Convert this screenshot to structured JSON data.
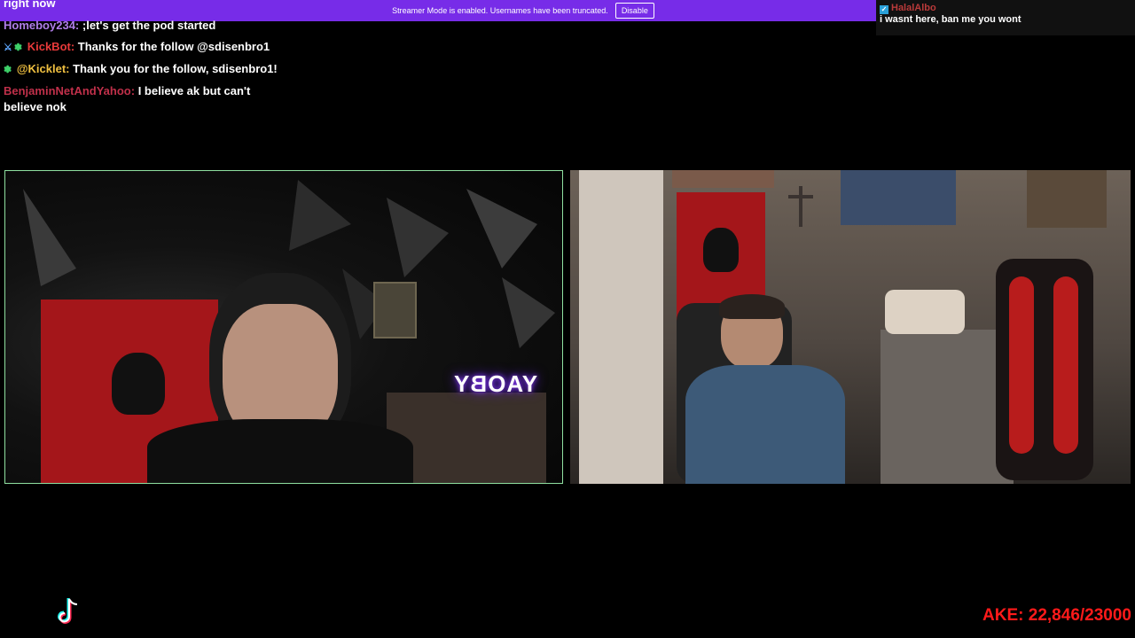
{
  "top_line": "right now",
  "banner": {
    "message": "Streamer Mode is enabled. Usernames have been truncated.",
    "button_label": "Disable",
    "color": "#772ce8"
  },
  "chat": [
    {
      "user": "Homeboy234:",
      "user_color": "#b07ee8",
      "text": ";let's get the pod started",
      "badges": []
    },
    {
      "user": "KickBot:",
      "user_color": "#e83a3a",
      "text": "Thanks for the follow @sdisenbro1",
      "badges": [
        "sword-icon",
        "gear-badge-icon"
      ]
    },
    {
      "user": "@Kicklet:",
      "user_color": "#f0c040",
      "text": "Thank you for the follow, sdisenbro1!",
      "badges": [
        "gear-badge-icon"
      ]
    },
    {
      "user": "BenjaminNetAndYahoo:",
      "user_color": "#c0304a",
      "text": "I believe ak but can't believe nok",
      "badges": []
    }
  ],
  "top_right_chat": {
    "user": "HalalAlbo",
    "text": "i wasnt here, ban me you wont"
  },
  "neon_sign": "YAOBY",
  "counter": "AKE: 22,846/23000",
  "colors": {
    "left_border": "#8fe0a0",
    "counter": "#ff1a1a"
  }
}
